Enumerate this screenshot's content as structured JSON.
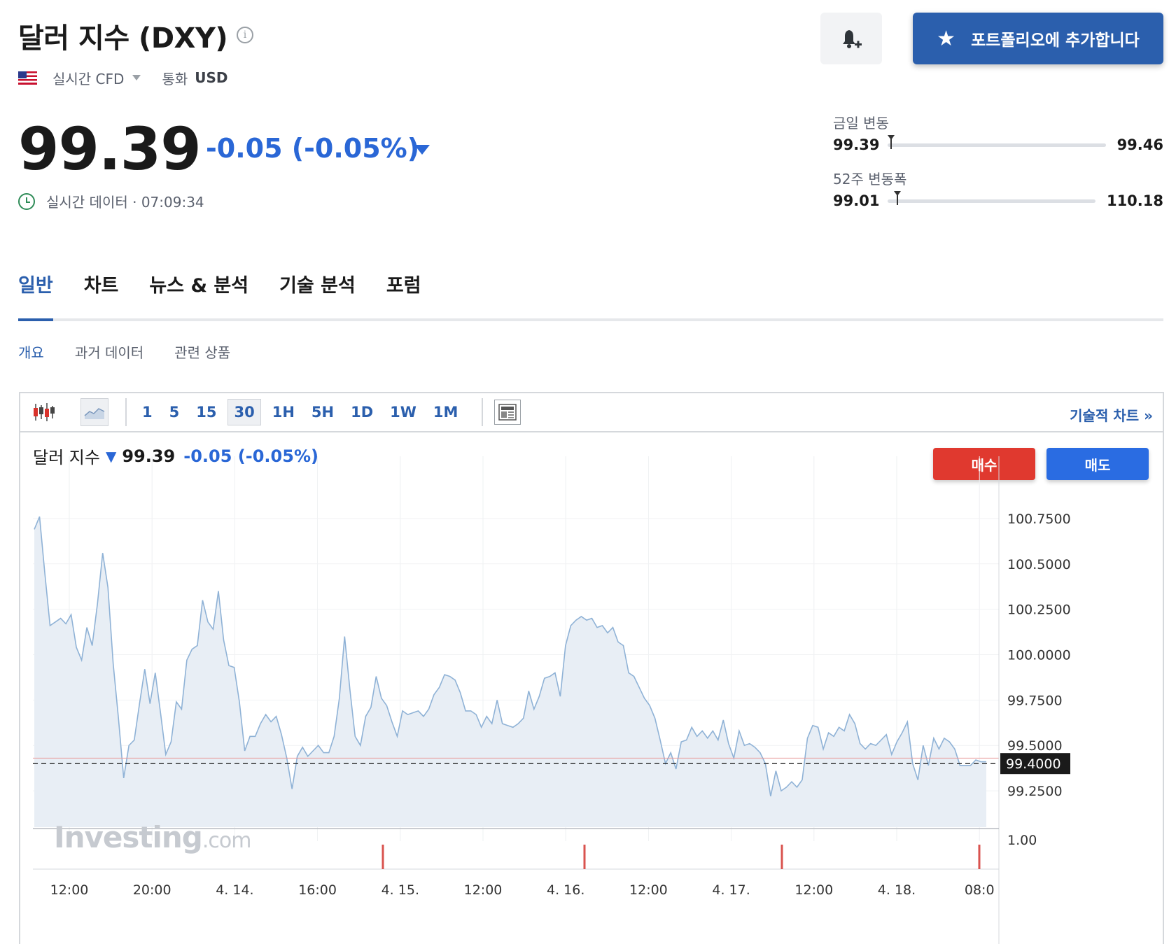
{
  "header": {
    "title": "달러 지수 (DXY)",
    "info_icon": "info-icon",
    "flag_icon": "us-flag-icon",
    "data_type": "실시간 CFD",
    "currency_label": "통화",
    "currency_value": "USD",
    "bell_icon": "bell-plus-icon",
    "portfolio_button": "포트폴리오에 추가합니다"
  },
  "quote": {
    "price": "99.39",
    "change": "-0.05 (-0.05%)",
    "direction": "down",
    "realtime_text": "실시간 데이터 · 07:09:34"
  },
  "ranges": {
    "day": {
      "label": "금일 변동",
      "low": "99.39",
      "high": "99.46",
      "position": 0.0
    },
    "week52": {
      "label": "52주 변동폭",
      "low": "99.01",
      "high": "110.18",
      "position": 0.03
    }
  },
  "tabs": [
    {
      "label": "일반",
      "active": true
    },
    {
      "label": "차트",
      "active": false
    },
    {
      "label": "뉴스 & 분석",
      "active": false
    },
    {
      "label": "기술 분석",
      "active": false
    },
    {
      "label": "포럼",
      "active": false
    }
  ],
  "subtabs": [
    {
      "label": "개요",
      "active": true
    },
    {
      "label": "과거 데이터",
      "active": false
    },
    {
      "label": "관련 상품",
      "active": false
    }
  ],
  "toolbar": {
    "candle_icon": "candlestick-icon",
    "area_icon": "area-chart-icon",
    "intervals": [
      "1",
      "5",
      "15",
      "30",
      "1H",
      "5H",
      "1D",
      "1W",
      "1M"
    ],
    "selected_interval": "30",
    "layout_icon": "layout-icon",
    "tech_chart_link": "기술적 차트",
    "tech_chart_chevron": "»"
  },
  "legend": {
    "name": "달러 지수",
    "arrow": "🡇",
    "price": "99.39",
    "change": "-0.05  (-0.05%)"
  },
  "trade": {
    "buy": "매수",
    "sell": "매도"
  },
  "watermark": {
    "brand": "Investing",
    "suffix": ".com"
  },
  "colors": {
    "accent": "#2b5fad",
    "down": "#2a67d6",
    "buy": "#e0392f",
    "sell": "#2a6ce2",
    "series_line": "#8fb2d6",
    "series_fill": "#e8eef5"
  },
  "chart_data": {
    "type": "area",
    "y_ticks": [
      "100.7500",
      "100.5000",
      "100.2500",
      "100.0000",
      "99.7500",
      "99.5000",
      "99.2500"
    ],
    "ylim": [
      99.05,
      100.9
    ],
    "current_value": "99.4000",
    "reference_line": 99.43,
    "x_ticks": [
      "12:00",
      "20:00",
      "4. 14.",
      "16:00",
      "4. 15.",
      "12:00",
      "4. 16.",
      "12:00",
      "4. 17.",
      "12:00",
      "4. 18.",
      "08:0"
    ],
    "volume_axis_label": "1.00",
    "series": [
      {
        "values": [
          100.69,
          100.76,
          100.45,
          100.16,
          100.18,
          100.2,
          100.17,
          100.22,
          100.04,
          99.97,
          100.15,
          100.05,
          100.28,
          100.56,
          100.37,
          99.95,
          99.65,
          99.32,
          99.5,
          99.53,
          99.73,
          99.92,
          99.73,
          99.9,
          99.68,
          99.45,
          99.52,
          99.74,
          99.7,
          99.97,
          100.03,
          100.05,
          100.3,
          100.18,
          100.14,
          100.35,
          100.08,
          99.94,
          99.93,
          99.74,
          99.47,
          99.55,
          99.55,
          99.62,
          99.67,
          99.63,
          99.66,
          99.56,
          99.43,
          99.26,
          99.44,
          99.49,
          99.44,
          99.47,
          99.5,
          99.46,
          99.46,
          99.55,
          99.76,
          100.1,
          99.81,
          99.55,
          99.5,
          99.66,
          99.71,
          99.88,
          99.76,
          99.72,
          99.63,
          99.55,
          99.69,
          99.67,
          99.68,
          99.69,
          99.66,
          99.7,
          99.78,
          99.82,
          99.89,
          99.88,
          99.86,
          99.79,
          99.69,
          99.69,
          99.67,
          99.6,
          99.66,
          99.62,
          99.75,
          99.62,
          99.61,
          99.6,
          99.62,
          99.65,
          99.8,
          99.7,
          99.77,
          99.87,
          99.88,
          99.9,
          99.77,
          100.05,
          100.16,
          100.19,
          100.21,
          100.19,
          100.2,
          100.15,
          100.16,
          100.12,
          100.15,
          100.07,
          100.05,
          99.9,
          99.88,
          99.82,
          99.76,
          99.72,
          99.65,
          99.53,
          99.4,
          99.46,
          99.37,
          99.52,
          99.53,
          99.6,
          99.55,
          99.58,
          99.54,
          99.58,
          99.53,
          99.64,
          99.51,
          99.43,
          99.58,
          99.5,
          99.51,
          99.49,
          99.46,
          99.4,
          99.22,
          99.36,
          99.25,
          99.27,
          99.3,
          99.27,
          99.31,
          99.54,
          99.61,
          99.6,
          99.48,
          99.57,
          99.55,
          99.6,
          99.58,
          99.67,
          99.62,
          99.51,
          99.48,
          99.51,
          99.5,
          99.53,
          99.56,
          99.45,
          99.52,
          99.57,
          99.63,
          99.4,
          99.31,
          99.5,
          99.39,
          99.54,
          99.48,
          99.54,
          99.52,
          99.48,
          99.39,
          99.39,
          99.39,
          99.42,
          99.41,
          99.41
        ]
      }
    ],
    "volume_markers": [
      "4. 15.",
      "4. 16.",
      "4. 17.",
      "4. 18."
    ]
  }
}
